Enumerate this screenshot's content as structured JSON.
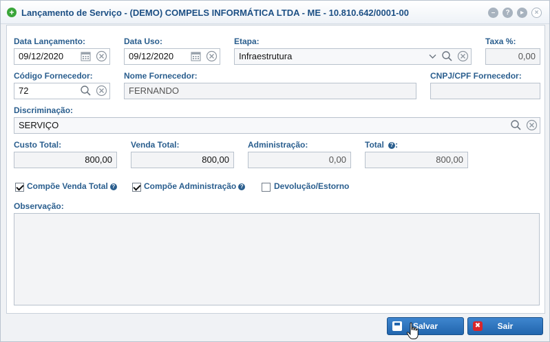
{
  "window": {
    "title": "Lançamento de Serviço - (DEMO) COMPELS INFORMÁTICA LTDA - ME - 10.810.642/0001-00"
  },
  "form": {
    "data_lancamento": {
      "label": "Data Lançamento:",
      "value": "09/12/2020"
    },
    "data_uso": {
      "label": "Data Uso:",
      "value": "09/12/2020"
    },
    "etapa": {
      "label": "Etapa:",
      "value": "Infraestrutura"
    },
    "taxa": {
      "label": "Taxa %:",
      "value": "0,00"
    },
    "codigo_fornecedor": {
      "label": "Código Fornecedor:",
      "value": "72"
    },
    "nome_fornecedor": {
      "label": "Nome Fornecedor:",
      "value": "FERNANDO"
    },
    "cnpj_fornecedor": {
      "label": "CNPJ/CPF Fornecedor:",
      "value": ""
    },
    "discriminacao": {
      "label": "Discriminação:",
      "value": "SERVIÇO"
    },
    "custo_total": {
      "label": "Custo Total:",
      "value": "800,00"
    },
    "venda_total": {
      "label": "Venda Total:",
      "value": "800,00"
    },
    "administracao": {
      "label": "Administração:",
      "value": "0,00"
    },
    "total": {
      "label": "Total",
      "value": "800,00"
    },
    "compoe_venda_total": {
      "label": "Compõe Venda Total",
      "checked": true
    },
    "compoe_administracao": {
      "label": "Compõe Administração",
      "checked": true
    },
    "devolucao_estorno": {
      "label": "Devolução/Estorno",
      "checked": false
    },
    "observacao": {
      "label": "Observação:",
      "value": ""
    }
  },
  "buttons": {
    "save_label": "Salvar",
    "exit_label": "Sair"
  },
  "colors": {
    "accent": "#2a5e8e",
    "button": "#2165ad",
    "title_icon": "#3aa63a",
    "exit_icon": "#d9262b"
  }
}
